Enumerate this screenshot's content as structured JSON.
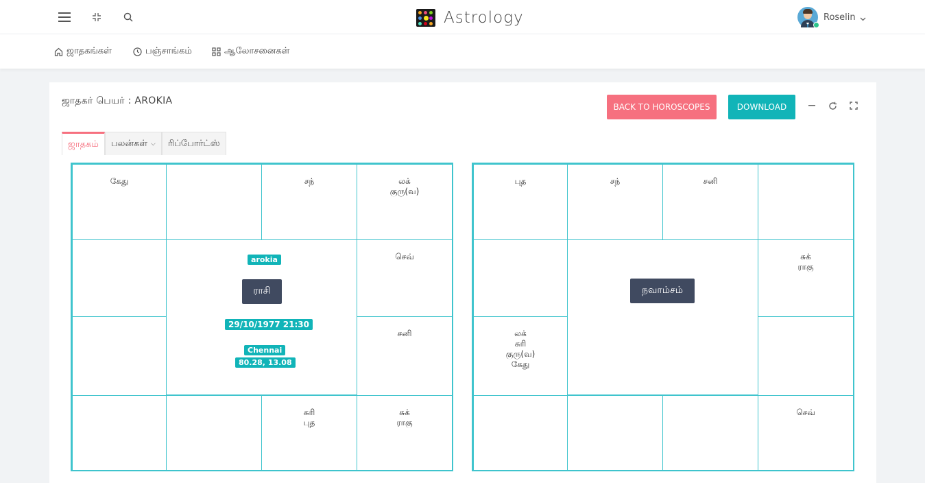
{
  "app": {
    "title": "Astrology"
  },
  "user": {
    "name": "Roselin"
  },
  "nav": [
    {
      "label": "ஜாதகங்கள்",
      "icon": "home-icon"
    },
    {
      "label": "பஞ்சாங்கம்",
      "icon": "clock-icon"
    },
    {
      "label": "ஆலோசனைகள்",
      "icon": "grid-icon"
    }
  ],
  "card": {
    "title": "ஜாதகர் பெயர் : AROKIA",
    "back_label": "BACK TO HOROSCOPES",
    "download_label": "DOWNLOAD"
  },
  "tabs": [
    "ஜாதகம்",
    "பலன்கள்",
    "ரிப்போர்ட்ஸ்"
  ],
  "rasi": {
    "label": "ராசி",
    "name": "arokia",
    "datetime": "29/10/1977 21:30",
    "place": "Chennai",
    "coords": "80.28, 13.08",
    "houses": [
      "கேது",
      "",
      "சந்",
      "லக்\nகுரு(வ)",
      "",
      "செவ்",
      "",
      "சனி",
      "",
      "",
      "சுரி\nபுத",
      "சுக்\nராகு"
    ]
  },
  "navamsa": {
    "label": "நவாம்சம்",
    "houses": [
      "புத",
      "சந்",
      "சனி",
      "",
      "",
      "சுக்\nராகு",
      "லக்\nசுரி\nகுரு(வ)\nகேது",
      "",
      "",
      "",
      "",
      "செவ்"
    ]
  },
  "colors": {
    "accent_pink": "#f6707f",
    "accent_teal": "#11b4b8",
    "grid": "#3fc4cd",
    "dark_label": "#404a60"
  }
}
